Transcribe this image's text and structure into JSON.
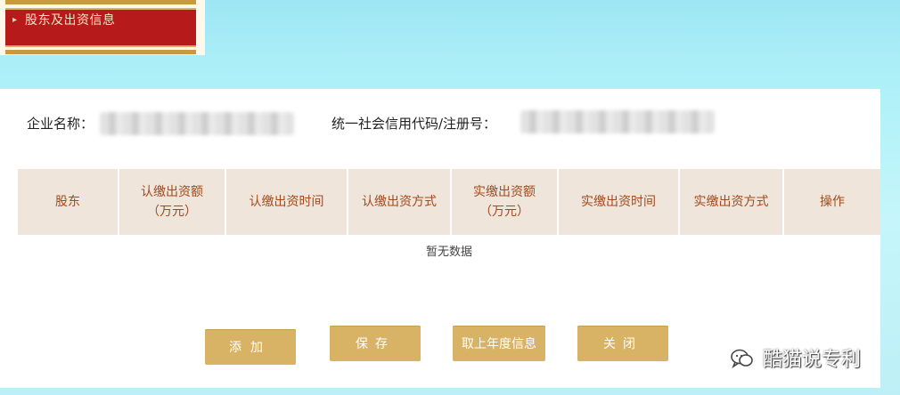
{
  "banner": {
    "arrow": "▸",
    "title": "股东及出资信息"
  },
  "info": {
    "company_label": "企业名称：",
    "code_label": "统一社会信用代码/注册号："
  },
  "table": {
    "headers": [
      "股东",
      "认缴出资额\n（万元）",
      "认缴出资时间",
      "认缴出资方式",
      "实缴出资额\n（万元）",
      "实缴出资时间",
      "实缴出资方式",
      "操作"
    ],
    "empty_text": "暂无数据"
  },
  "buttons": {
    "add": "添加",
    "save": "保存",
    "fetch": "取上年度信息",
    "close": "关闭"
  },
  "watermark": {
    "text": "酷猫说专利",
    "icon": "wechat-icon"
  },
  "colors": {
    "banner_red": "#b71a1b",
    "header_bg": "#efe5db",
    "header_text": "#a24a1b",
    "button_gold": "#d8b265"
  }
}
